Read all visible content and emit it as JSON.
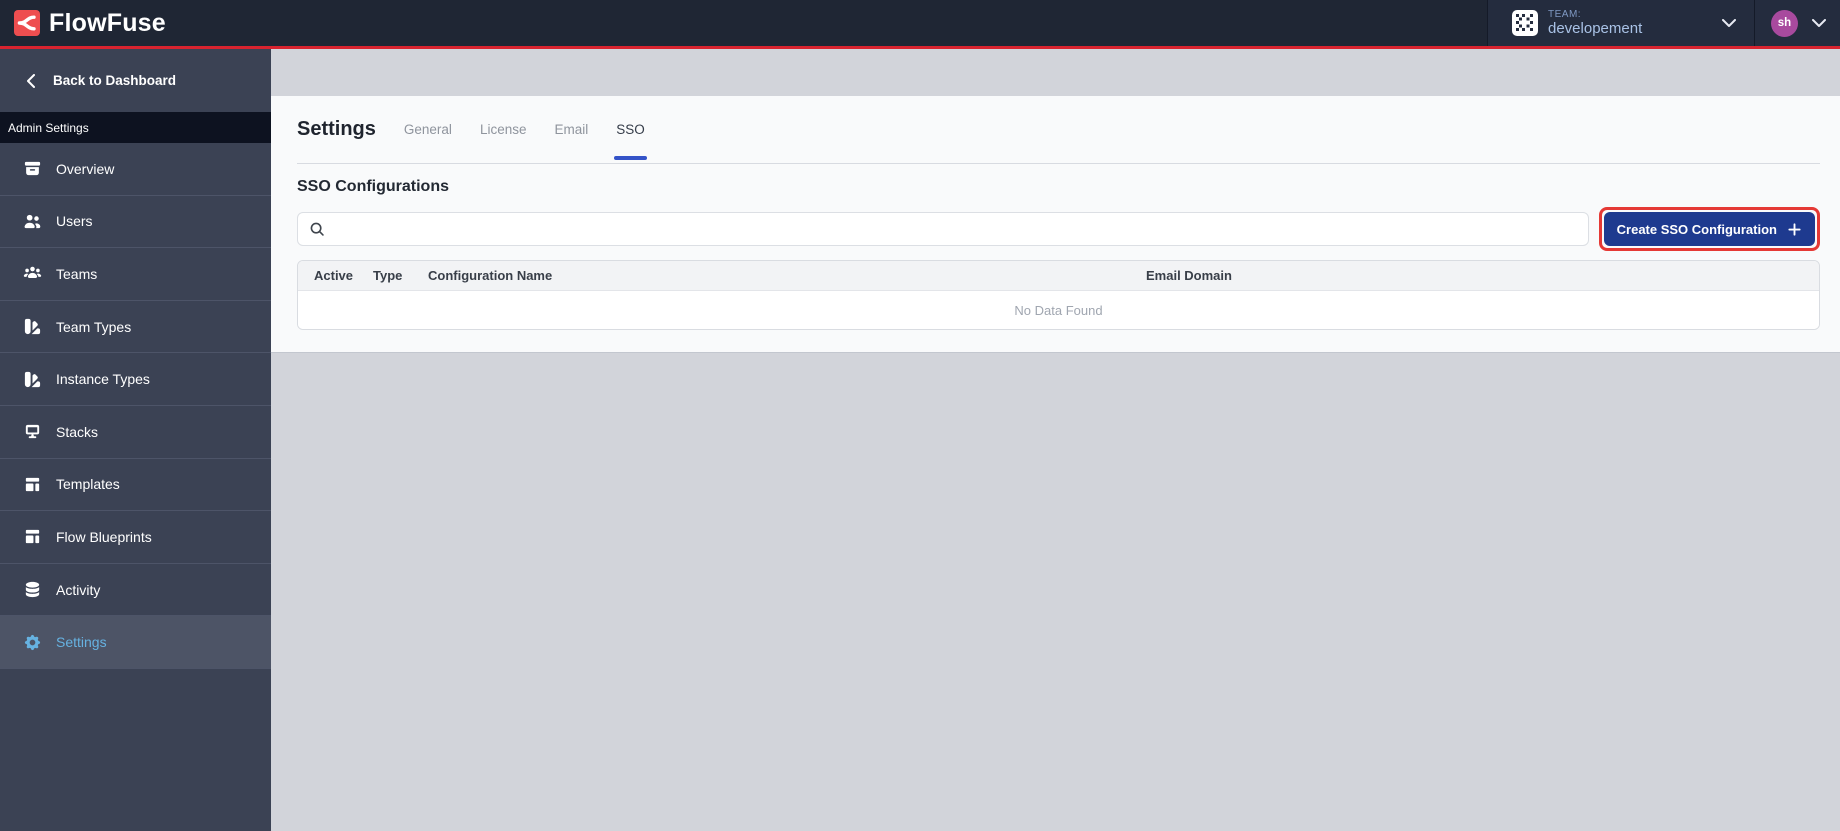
{
  "brand": {
    "name": "FlowFuse"
  },
  "header": {
    "team_label": "TEAM:",
    "team_name": "developement",
    "avatar_initials": "sh"
  },
  "sidebar": {
    "back_label": "Back to Dashboard",
    "section_label": "Admin Settings",
    "items": [
      {
        "label": "Overview",
        "icon": "archive-icon",
        "active": false
      },
      {
        "label": "Users",
        "icon": "users-icon",
        "active": false
      },
      {
        "label": "Teams",
        "icon": "user-group-icon",
        "active": false
      },
      {
        "label": "Team Types",
        "icon": "color-swatch-icon",
        "active": false
      },
      {
        "label": "Instance Types",
        "icon": "color-swatch-icon",
        "active": false
      },
      {
        "label": "Stacks",
        "icon": "desktop-icon",
        "active": false
      },
      {
        "label": "Templates",
        "icon": "template-icon",
        "active": false
      },
      {
        "label": "Flow Blueprints",
        "icon": "template-icon",
        "active": false
      },
      {
        "label": "Activity",
        "icon": "database-icon",
        "active": false
      },
      {
        "label": "Settings",
        "icon": "cog-icon",
        "active": true
      }
    ]
  },
  "main": {
    "title": "Settings",
    "tabs": [
      {
        "label": "General",
        "active": false
      },
      {
        "label": "License",
        "active": false
      },
      {
        "label": "Email",
        "active": false
      },
      {
        "label": "SSO",
        "active": true
      }
    ],
    "section_title": "SSO Configurations",
    "search": {
      "value": "",
      "placeholder": ""
    },
    "create_button_label": "Create SSO Configuration",
    "table": {
      "columns": [
        "Active",
        "Type",
        "Configuration Name",
        "Email Domain"
      ],
      "rows": [],
      "empty_text": "No Data Found"
    }
  },
  "colors": {
    "header-bg": "#1f2634",
    "panel-bg": "#242c3e",
    "red-line": "#d8232f",
    "logo-red": "#ee4e50",
    "sidebar-bg": "#3b4254",
    "sidebar-dark": "#0d1220",
    "sidebar-active-bg": "#4d5466",
    "active-blue": "#66b2e1",
    "content-bg": "#d2d4da",
    "surface": "#f9fafb",
    "tab-underline": "#3453c8",
    "button-navy": "#1e3a8f",
    "highlight-red": "#e53935",
    "avatar-purple": "#a84a9e",
    "team-text": "#a9c2e6"
  }
}
